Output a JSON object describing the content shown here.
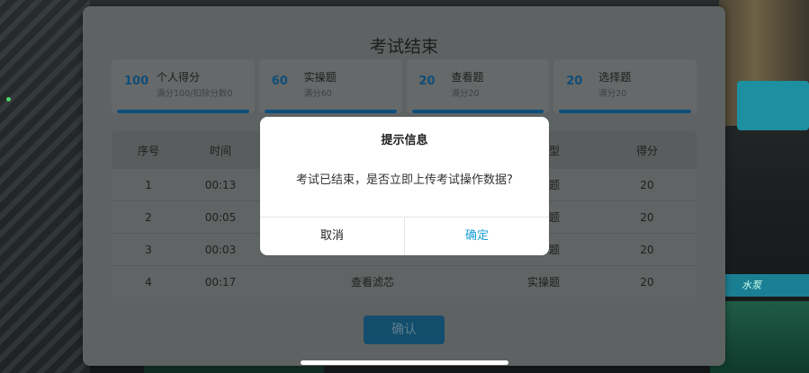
{
  "panel": {
    "title": "考试结束",
    "confirm_label": "确认"
  },
  "cards": [
    {
      "value": "100",
      "name": "个人得分",
      "sub": "满分100/扣除分数0"
    },
    {
      "value": "60",
      "name": "实操题",
      "sub": "满分60"
    },
    {
      "value": "20",
      "name": "查看题",
      "sub": "满分20"
    },
    {
      "value": "20",
      "name": "选择题",
      "sub": "满分20"
    }
  ],
  "table": {
    "headers": [
      "序号",
      "时间",
      "",
      "目类型",
      "得分"
    ],
    "rows": [
      [
        "1",
        "00:13",
        "",
        "实操题",
        "20"
      ],
      [
        "2",
        "00:05",
        "",
        "查看题",
        "20"
      ],
      [
        "3",
        "00:03",
        "",
        "选择题",
        "20"
      ],
      [
        "4",
        "00:17",
        "查看滤芯",
        "实操题",
        "20"
      ]
    ]
  },
  "modal": {
    "title": "提示信息",
    "message": "考试已结束，是否立即上传考试操作数据?",
    "cancel_label": "取消",
    "ok_label": "确定"
  },
  "scene": {
    "plate_text": "水泵"
  },
  "colors": {
    "accent": "#1aa0d8",
    "panel": "#5f6262",
    "bar": "#0d4f7d"
  }
}
